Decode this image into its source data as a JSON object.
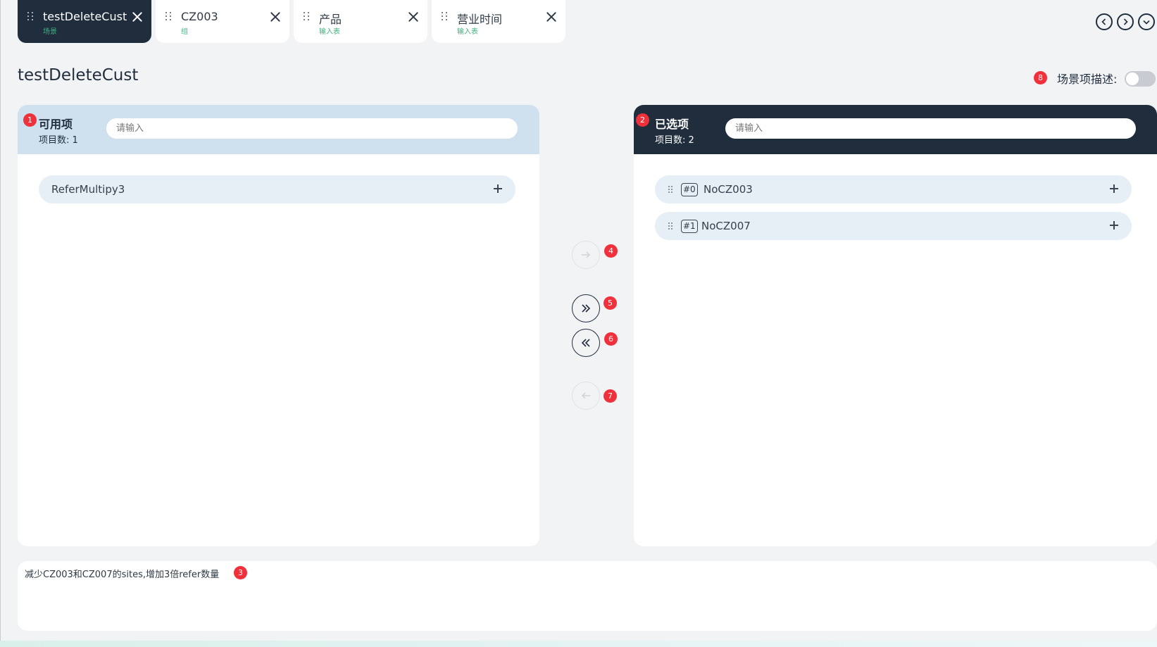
{
  "tabs": [
    {
      "title": "testDeleteCust",
      "subtitle": "场景",
      "active": true
    },
    {
      "title": "CZ003",
      "subtitle": "组",
      "active": false
    },
    {
      "title": "产品",
      "subtitle": "输入表",
      "active": false
    },
    {
      "title": "营业时间",
      "subtitle": "输入表",
      "active": false
    }
  ],
  "nav_icons": [
    "circle-chevron-left-icon",
    "circle-chevron-right-icon",
    "circle-chevron-down-icon"
  ],
  "page": {
    "title": "testDeleteCust"
  },
  "scene_description": {
    "label": "场景项描述:",
    "badge": "8",
    "enabled": false
  },
  "available": {
    "badge": "1",
    "title": "可用项",
    "count_label": "项目数:",
    "count": "1",
    "search_placeholder": "请输入",
    "items": [
      {
        "label": "ReferMultipy3"
      }
    ]
  },
  "selected": {
    "badge": "2",
    "title": "已选项",
    "count_label": "项目数:",
    "count": "2",
    "search_placeholder": "请输入",
    "items": [
      {
        "index": "#0",
        "label": "NoCZ003"
      },
      {
        "index": "#1",
        "label": "NoCZ007"
      }
    ]
  },
  "transfer_buttons": [
    {
      "badge": "4",
      "icon": "arrow-right-icon",
      "enabled": false
    },
    {
      "badge": "5",
      "icon": "double-chevron-right-icon",
      "enabled": true
    },
    {
      "badge": "6",
      "icon": "double-chevron-left-icon",
      "enabled": true
    },
    {
      "badge": "7",
      "icon": "arrow-left-icon",
      "enabled": false
    }
  ],
  "description": {
    "text": "减少CZ003和CZ007的sites,增加3倍refer数量",
    "badge": "3"
  },
  "colors": {
    "dark": "#1f2d3d",
    "accent_light": "#cfe0ee",
    "badge": "#f0303a",
    "subtitle_green": "#3fb27f",
    "row": "#e6eef6",
    "background": "#f2f3f5"
  }
}
